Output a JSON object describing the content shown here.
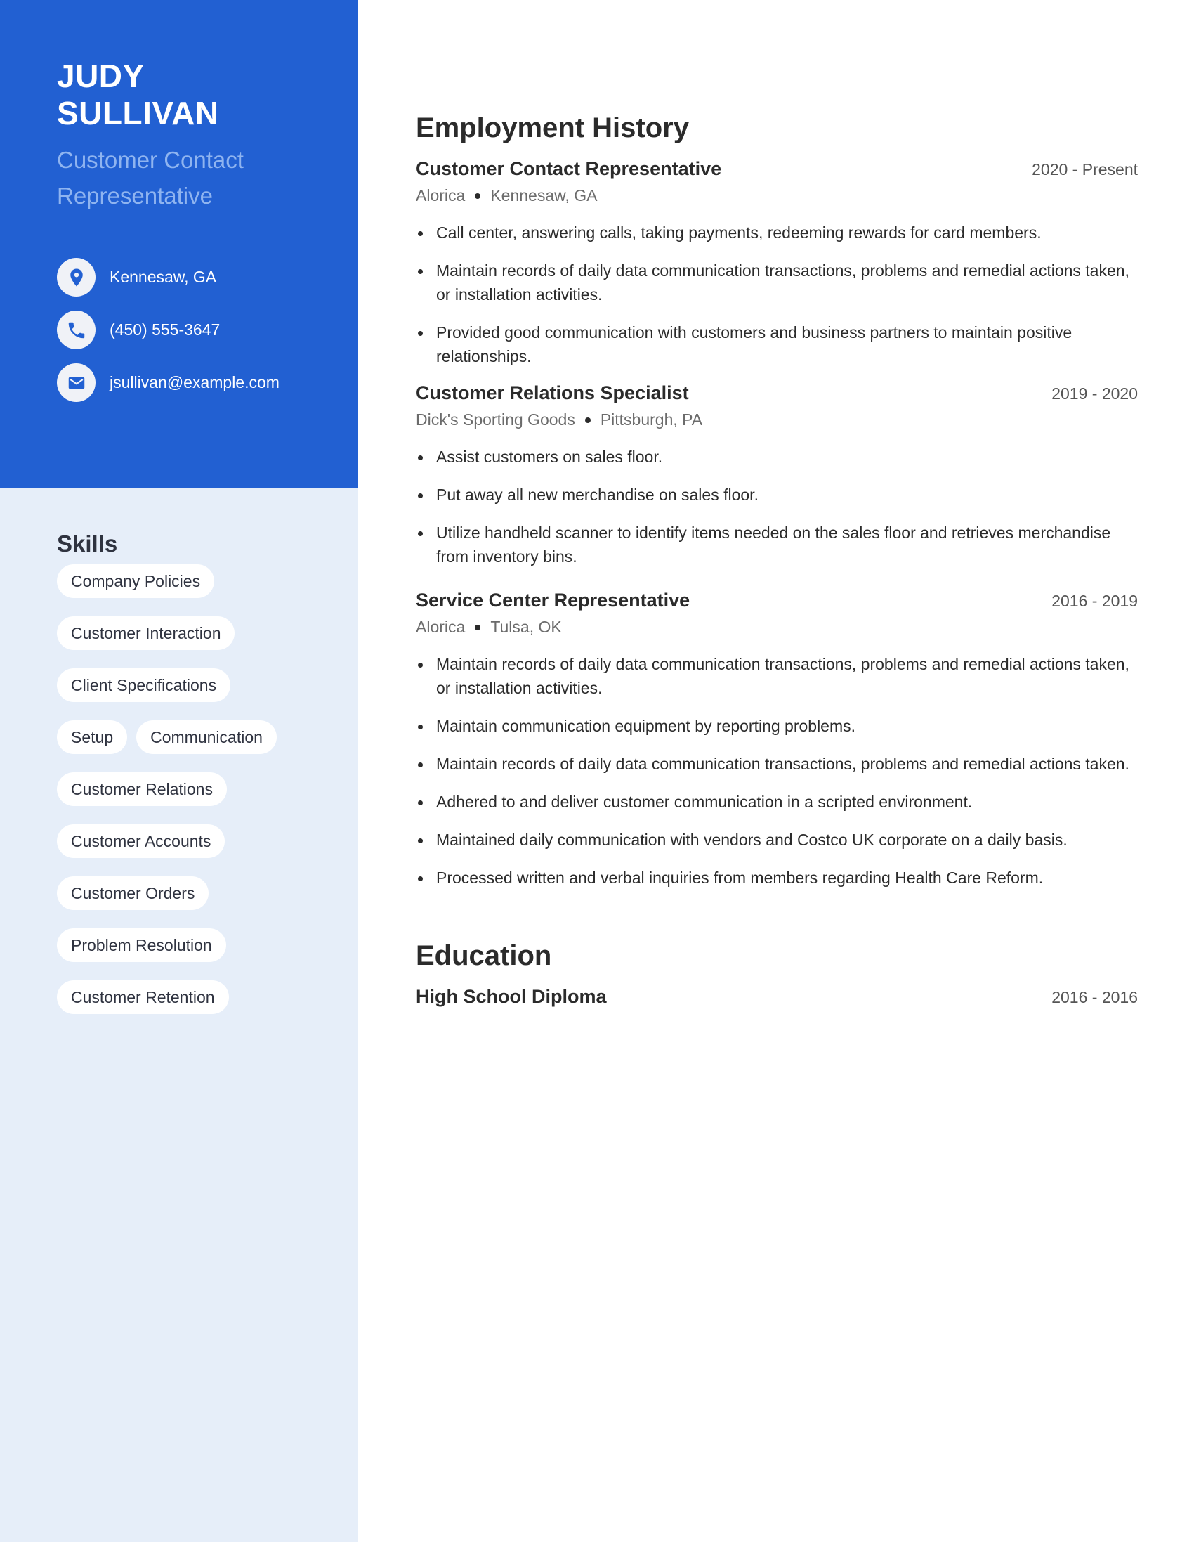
{
  "profile": {
    "first_name": "JUDY",
    "last_name": "SULLIVAN",
    "headline": "Customer Contact Representative"
  },
  "colors": {
    "brand_blue": "#2260d2",
    "sidebar_light": "#e6eef9",
    "headline_blue": "#8fb4f0"
  },
  "contacts": [
    {
      "icon": "map-pin-icon",
      "text": "Kennesaw, GA"
    },
    {
      "icon": "phone-icon",
      "text": "(450) 555-3647"
    },
    {
      "icon": "envelope-icon",
      "text": "jsullivan@example.com"
    }
  ],
  "skills": {
    "title": "Skills",
    "items": [
      "Company Policies",
      "Customer Interaction",
      "Client Specifications",
      "Setup",
      "Communication",
      "Customer Relations",
      "Customer Accounts",
      "Customer Orders",
      "Problem Resolution",
      "Customer Retention"
    ]
  },
  "employment": {
    "title": "Employment History",
    "jobs": [
      {
        "title": "Customer Contact Representative",
        "dates": "2020 - Present",
        "company": "Alorica",
        "location": "Kennesaw, GA",
        "bullets": [
          "Call center, answering calls, taking payments, redeeming rewards for card members.",
          "Maintain records of daily data communication transactions, problems and remedial actions taken, or installation activities.",
          "Provided good communication with customers and business partners to maintain positive relationships."
        ]
      },
      {
        "title": "Customer Relations Specialist",
        "dates": "2019 - 2020",
        "company": "Dick's Sporting Goods",
        "location": "Pittsburgh, PA",
        "bullets": [
          "Assist customers on sales floor.",
          "Put away all new merchandise on sales floor.",
          "Utilize handheld scanner to identify items needed on the sales floor and retrieves merchandise from inventory bins."
        ]
      },
      {
        "title": "Service Center Representative",
        "dates": "2016 - 2019",
        "company": "Alorica",
        "location": "Tulsa, OK",
        "bullets": [
          "Maintain records of daily data communication transactions, problems and remedial actions taken, or installation activities.",
          "Maintain communication equipment by reporting problems.",
          "Maintain records of daily data communication transactions, problems and remedial actions taken.",
          "Adhered to and deliver customer communication in a scripted environment.",
          "Maintained daily communication with vendors and Costco UK corporate on a daily basis.",
          "Processed written and verbal inquiries from members regarding Health Care Reform."
        ]
      }
    ]
  },
  "education": {
    "title": "Education",
    "items": [
      {
        "degree": "High School Diploma",
        "dates": "2016 - 2016"
      }
    ]
  }
}
